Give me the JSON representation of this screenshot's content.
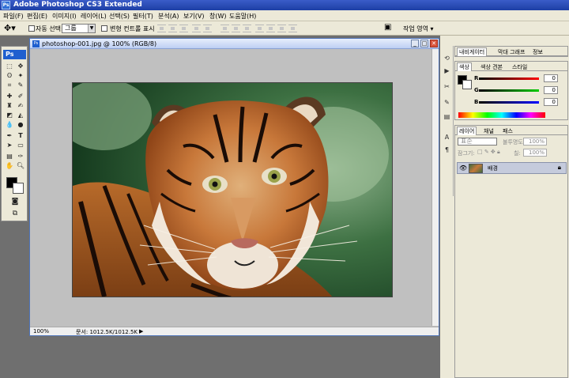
{
  "window": {
    "title": "Adobe Photoshop CS3 Extended",
    "app_icon": "Ps"
  },
  "menu": [
    "파일(F)",
    "편집(E)",
    "이미지(I)",
    "레이어(L)",
    "선택(S)",
    "필터(T)",
    "분석(A)",
    "보기(V)",
    "창(W)",
    "도움말(H)"
  ],
  "options": {
    "auto_select_label": "자동 선택:",
    "auto_select_value": "그룹",
    "transform_label": "변형 컨트롤 표시",
    "workspace_label": "작업 영역 ▾"
  },
  "toolbox": {
    "logo": "Ps"
  },
  "document": {
    "title": "photoshop-001.jpg @ 100% (RGB/8)",
    "zoom": "100%",
    "doc_size": "문서: 1012.5K/1012.5K",
    "image_description_icon": "tiger-photo"
  },
  "panels": {
    "navigator_tabs": [
      "내비게이터",
      "막대 그래프",
      "정보"
    ],
    "color_tabs": [
      "색상",
      "색상 견본",
      "스타일"
    ],
    "color": {
      "r_label": "R",
      "g_label": "G",
      "b_label": "B",
      "r": "0",
      "g": "0",
      "b": "0",
      "colors": {
        "foreground": "#000000"
      }
    },
    "layer_tabs": [
      "레이어",
      "채널",
      "패스"
    ],
    "layer_blend": "표준",
    "opacity_label": "불투명도:",
    "opacity_value": "100%",
    "lock_label": "잠그기:",
    "fill_label": "칠:",
    "fill_value": "100%",
    "layer_name": "배경"
  }
}
